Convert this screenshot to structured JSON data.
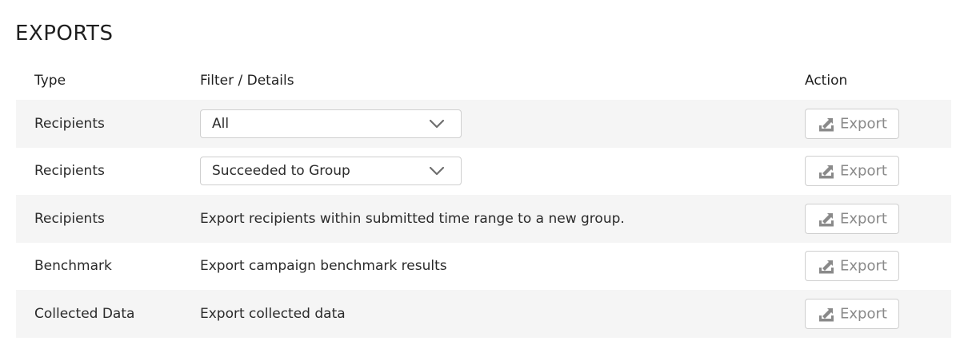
{
  "page": {
    "title": "EXPORTS"
  },
  "table": {
    "headers": {
      "type": "Type",
      "details": "Filter / Details",
      "action": "Action"
    },
    "rows": [
      {
        "type": "Recipients",
        "filter_value": "All",
        "action_label": "Export"
      },
      {
        "type": "Recipients",
        "filter_value": "Succeeded to Group",
        "action_label": "Export"
      },
      {
        "type": "Recipients",
        "details": "Export recipients within submitted time range to a new group.",
        "action_label": "Export"
      },
      {
        "type": "Benchmark",
        "details": "Export campaign benchmark results",
        "action_label": "Export"
      },
      {
        "type": "Collected Data",
        "details": "Export collected data",
        "action_label": "Export"
      }
    ]
  },
  "icons": {
    "dropdown": "chevron-down-icon",
    "export": "export-icon"
  },
  "colors": {
    "row_shade": "#f5f5f5",
    "button_text": "#8a8a8a",
    "border": "#cfcfcf"
  }
}
